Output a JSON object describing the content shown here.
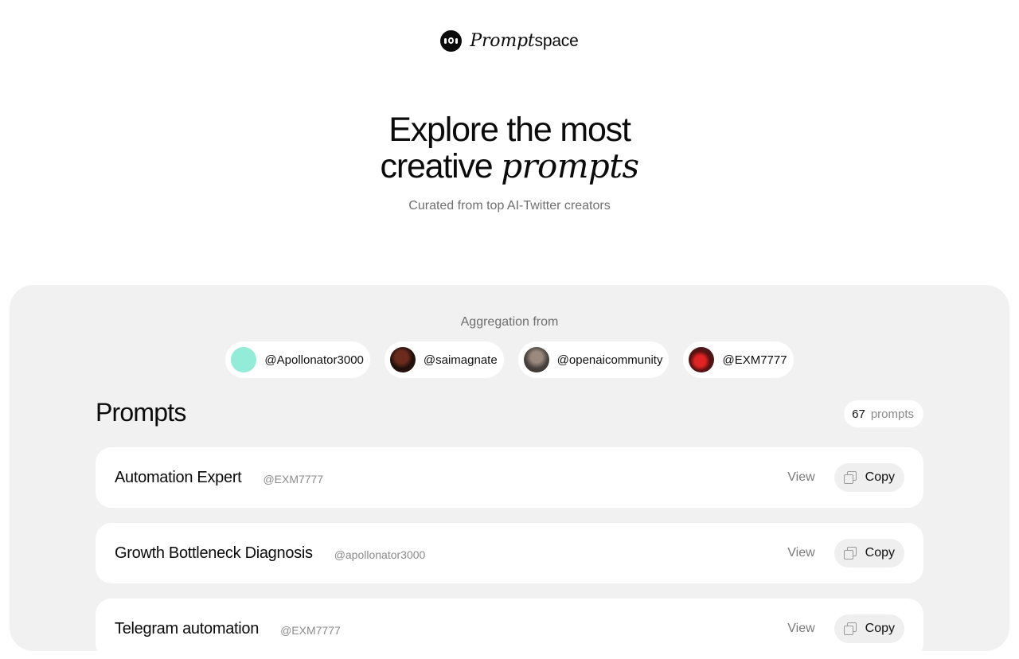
{
  "brand": {
    "name_italic": "Prompt",
    "name_plain": "space"
  },
  "hero": {
    "line1": "Explore the most",
    "line2_plain": "creative ",
    "line2_italic": "prompts",
    "subtitle": "Curated from top AI-Twitter creators"
  },
  "aggregation": {
    "title": "Aggregation from",
    "creators": [
      {
        "handle": "@Apollonator3000",
        "avatar": "teal-avatar"
      },
      {
        "handle": "@saimagnate",
        "avatar": "photo-avatar"
      },
      {
        "handle": "@openaicommunity",
        "avatar": "photo-avatar"
      },
      {
        "handle": "@EXM7777",
        "avatar": "photo-avatar"
      }
    ]
  },
  "prompts": {
    "title": "Prompts",
    "count": "67",
    "count_label": "prompts",
    "view_label": "View",
    "copy_label": "Copy",
    "items": [
      {
        "title": "Automation Expert",
        "author": "@EXM7777"
      },
      {
        "title": "Growth Bottleneck Diagnosis",
        "author": "@apollonator3000"
      },
      {
        "title": "Telegram automation",
        "author": "@EXM7777"
      }
    ]
  },
  "colors": {
    "panel_bg": "#f1f1f1",
    "card_bg": "#ffffff",
    "muted_text": "#8a8a8a",
    "teal_avatar": "#92ecd8"
  }
}
